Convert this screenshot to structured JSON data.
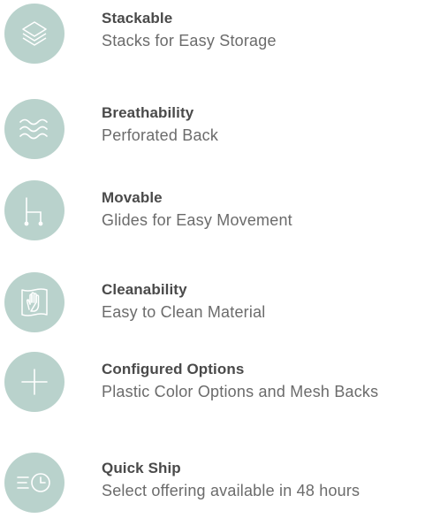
{
  "features": [
    {
      "title": "Stackable",
      "subtitle": "Stacks for Easy Storage",
      "icon": "stack-layers-icon"
    },
    {
      "title": "Breathability",
      "subtitle": "Perforated Back",
      "icon": "air-waves-icon"
    },
    {
      "title": "Movable",
      "subtitle": "Glides for Easy Movement",
      "icon": "chair-icon"
    },
    {
      "title": "Cleanability",
      "subtitle": "Easy to Clean Material",
      "icon": "hand-wipe-icon"
    },
    {
      "title": "Configured Options",
      "subtitle": "Plastic Color Options and Mesh Backs",
      "icon": "plus-icon"
    },
    {
      "title": "Quick Ship",
      "subtitle": "Select offering available in 48 hours",
      "icon": "fast-clock-icon"
    }
  ],
  "colors": {
    "icon_circle": "#b9d2cc",
    "icon_stroke": "#ffffff",
    "title": "#4a4a4a",
    "subtitle": "#6b6b6b"
  }
}
